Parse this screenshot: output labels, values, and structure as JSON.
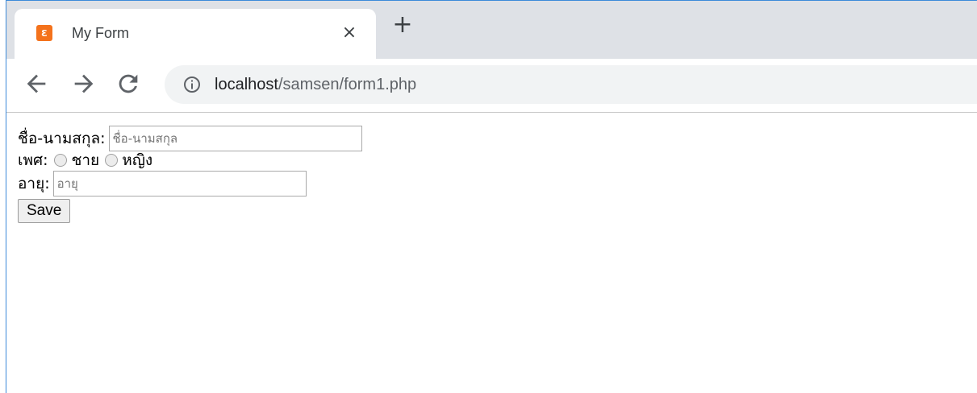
{
  "browser": {
    "tab": {
      "favicon_glyph": "ε",
      "title": "My Form",
      "close_label": "×"
    },
    "new_tab_label": "+",
    "address_bar": {
      "host": "localhost",
      "path": "/samsen/form1.php"
    }
  },
  "form": {
    "name_label": "ชื่อ-นามสกุล:",
    "name_placeholder": "ชื่อ-นามสกุล",
    "name_value": "",
    "gender_label": "เพศ:",
    "gender_options": [
      {
        "label": "ชาย",
        "selected": false
      },
      {
        "label": "หญิง",
        "selected": false
      }
    ],
    "age_label": "อายุ:",
    "age_placeholder": "อายุ",
    "age_value": "",
    "save_label": "Save"
  },
  "colors": {
    "favicon": "#f4721c",
    "tabstrip": "#dee1e6",
    "omnibox": "#f1f3f4",
    "window_border": "#3c8ad9"
  },
  "icons": {
    "favicon": "xampp-icon",
    "back": "arrow-left-icon",
    "forward": "arrow-right-icon",
    "reload": "reload-icon",
    "info": "info-icon",
    "close": "close-icon",
    "new_tab": "plus-icon"
  }
}
